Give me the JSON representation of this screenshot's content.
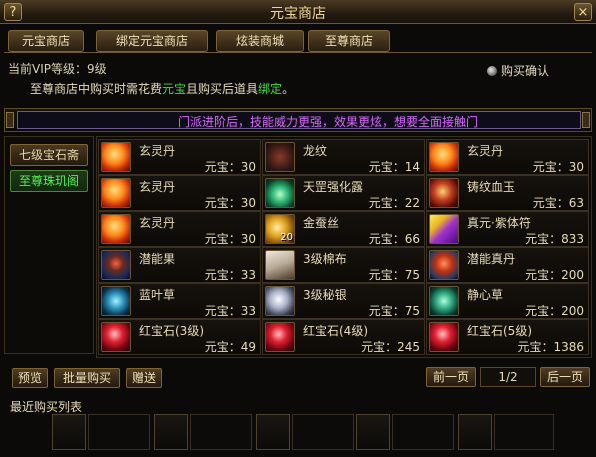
{
  "window": {
    "title": "元宝商店",
    "help": "?",
    "close": "×"
  },
  "tabs": [
    {
      "label": "元宝商店"
    },
    {
      "label": "绑定元宝商店"
    },
    {
      "label": "炫装商城"
    },
    {
      "label": "至尊商店"
    }
  ],
  "vip_level": "当前VIP等级：9级",
  "purchase_confirm": "购买确认",
  "notice": {
    "prefix": "至尊商店中购买时需花费",
    "currency": "元宝",
    "middle": "且购买后道具",
    "bind": "绑定",
    "suffix": "。"
  },
  "marquee": "门派进阶后，技能威力更强，效果更炫，想要全面接触门",
  "categories": [
    {
      "label": "七级宝石斋",
      "active": false
    },
    {
      "label": "至尊珠玑阁",
      "active": true
    }
  ],
  "items": [
    {
      "name": "玄灵丹",
      "price": "元宝：30",
      "icon": "orange-orb-icon"
    },
    {
      "name": "龙纹",
      "price": "元宝：14",
      "icon": "dragon-pattern-icon"
    },
    {
      "name": "玄灵丹",
      "price": "元宝：30",
      "icon": "orange-orb-icon"
    },
    {
      "name": "玄灵丹",
      "price": "元宝：30",
      "icon": "orange-orb-icon"
    },
    {
      "name": "天罡强化露",
      "price": "元宝：22",
      "icon": "potion-bottle-icon"
    },
    {
      "name": "铸纹血玉",
      "price": "元宝：63",
      "icon": "blood-jade-icon"
    },
    {
      "name": "玄灵丹",
      "price": "元宝：30",
      "icon": "orange-orb-icon"
    },
    {
      "name": "金蚕丝",
      "price": "元宝：66",
      "icon": "gold-silk-icon",
      "badge": "20"
    },
    {
      "name": "真元·紫体符",
      "price": "元宝：833",
      "icon": "purple-talisman-icon"
    },
    {
      "name": "潜能果",
      "price": "元宝：33",
      "icon": "potential-fruit-icon"
    },
    {
      "name": "3级棉布",
      "price": "元宝：75",
      "icon": "cotton-cloth-icon"
    },
    {
      "name": "潜能真丹",
      "price": "元宝：200",
      "icon": "true-pill-icon"
    },
    {
      "name": "蓝叶草",
      "price": "元宝：33",
      "icon": "blue-leaf-herb-icon"
    },
    {
      "name": "3级秘银",
      "price": "元宝：75",
      "icon": "mithril-icon"
    },
    {
      "name": "静心草",
      "price": "元宝：200",
      "icon": "calm-herb-icon"
    },
    {
      "name": "红宝石(3级)",
      "price": "元宝：49",
      "icon": "ruby-icon"
    },
    {
      "name": "红宝石(4级)",
      "price": "元宝：245",
      "icon": "ruby-icon"
    },
    {
      "name": "红宝石(5级)",
      "price": "元宝：1386",
      "icon": "ruby-icon"
    }
  ],
  "actions": {
    "preview": "预览",
    "bulk_buy": "批量购买",
    "gift": "赠送"
  },
  "pager": {
    "prev": "前一页",
    "indicator": "1/2",
    "next": "后一页"
  },
  "recent": {
    "title": "最近购买列表"
  },
  "colors": {
    "highlight_green": "#3fe03f",
    "marquee_purple": "#d868ff",
    "gold_text": "#f0d890"
  }
}
